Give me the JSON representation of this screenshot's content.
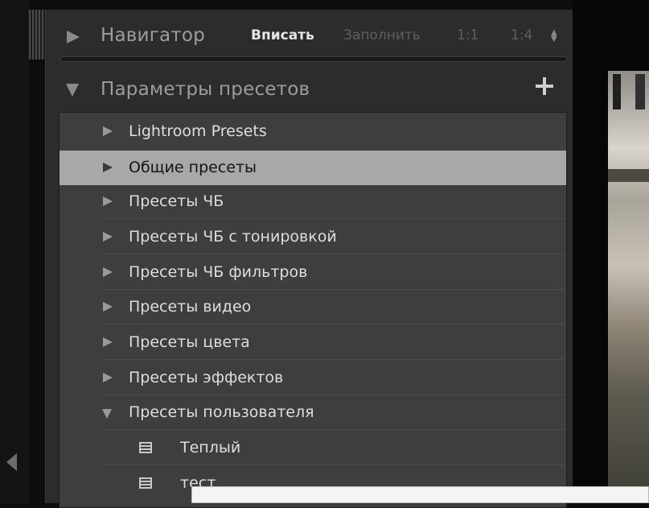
{
  "navigator": {
    "title": "Навигатор",
    "zoom_options": [
      "Вписать",
      "Заполнить",
      "1:1",
      "1:4"
    ],
    "active_zoom": "Вписать"
  },
  "presets": {
    "title": "Параметры пресетов",
    "folders": [
      {
        "label": "Lightroom Presets",
        "expanded": false,
        "selected": false
      },
      {
        "label": "Общие пресеты",
        "expanded": false,
        "selected": true
      },
      {
        "label": "Пресеты ЧБ",
        "expanded": false,
        "selected": false
      },
      {
        "label": "Пресеты ЧБ с тонировкой",
        "expanded": false,
        "selected": false
      },
      {
        "label": "Пресеты ЧБ фильтров",
        "expanded": false,
        "selected": false
      },
      {
        "label": "Пресеты видео",
        "expanded": false,
        "selected": false
      },
      {
        "label": "Пресеты цвета",
        "expanded": false,
        "selected": false
      },
      {
        "label": "Пресеты эффектов",
        "expanded": false,
        "selected": false
      },
      {
        "label": "Пресеты пользователя",
        "expanded": true,
        "selected": false
      }
    ],
    "user_presets": [
      "Теплый",
      "тест"
    ]
  },
  "colors": {
    "panel_bg": "#2c2c2c",
    "list_bg": "#3e3e3e",
    "selected_row": "#a8a8a8",
    "active_zoom_text": "#e6e6e6"
  }
}
